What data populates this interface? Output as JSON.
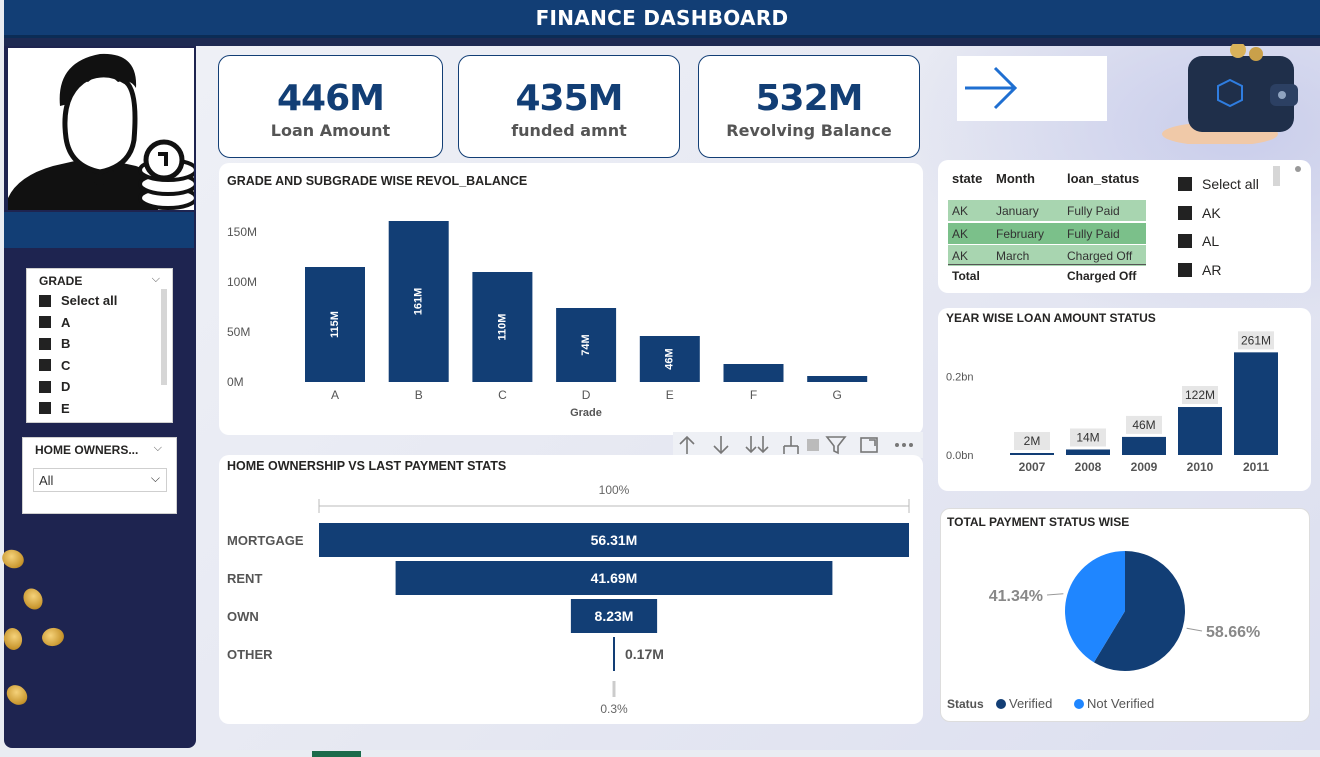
{
  "header": {
    "title": "FINANCE DASHBOARD"
  },
  "kpis": [
    {
      "value": "446M",
      "label": "Loan Amount"
    },
    {
      "value": "435M",
      "label": "funded amnt"
    },
    {
      "value": "532M",
      "label": "Revolving Balance"
    }
  ],
  "grade_slicer": {
    "title": "GRADE",
    "items": [
      "Select all",
      "A",
      "B",
      "C",
      "D",
      "E"
    ]
  },
  "home_slicer": {
    "title": "HOME OWNERS...",
    "selected": "All"
  },
  "state_table": {
    "headers": [
      "state",
      "Month",
      "loan_status"
    ],
    "rows": [
      [
        "AK",
        "January",
        "Fully Paid"
      ],
      [
        "AK",
        "February",
        "Fully Paid"
      ],
      [
        "AK",
        "March",
        "Charged Off"
      ]
    ],
    "total": [
      "Total",
      "",
      "Charged Off"
    ]
  },
  "state_slicer": {
    "items": [
      "Select all",
      "AK",
      "AL",
      "AR"
    ]
  },
  "colors": {
    "primary": "#123e75",
    "light_blue": "#1f86ff",
    "table_row": "#a8d5b0",
    "table_row_alt": "#7bc08a"
  },
  "chart_data": [
    {
      "type": "bar",
      "title": "GRADE AND SUBGRADE WISE REVOL_BALANCE",
      "xlabel": "Grade",
      "ylabel": "",
      "categories": [
        "A",
        "B",
        "C",
        "D",
        "E",
        "F",
        "G"
      ],
      "values": [
        115,
        161,
        110,
        74,
        46,
        18,
        6
      ],
      "data_labels": [
        "115M",
        "161M",
        "110M",
        "74M",
        "46M",
        "",
        ""
      ],
      "yticks": [
        "0M",
        "50M",
        "100M",
        "150M"
      ],
      "ylim": [
        0,
        170
      ],
      "unit": "M"
    },
    {
      "type": "bar",
      "title": "YEAR WISE LOAN AMOUNT STATUS",
      "categories": [
        "2007",
        "2008",
        "2009",
        "2010",
        "2011"
      ],
      "values": [
        2,
        14,
        46,
        122,
        261
      ],
      "data_labels": [
        "2M",
        "14M",
        "46M",
        "122M",
        "261M"
      ],
      "yticks": [
        "0.0bn",
        "0.2bn"
      ],
      "ylim": [
        0,
        300
      ]
    },
    {
      "type": "bar",
      "title": "HOME OWNERSHIP VS LAST PAYMENT STATS",
      "categories": [
        "MORTGAGE",
        "RENT",
        "OWN",
        "OTHER"
      ],
      "values": [
        56.31,
        41.69,
        8.23,
        0.17
      ],
      "data_labels": [
        "56.31M",
        "41.69M",
        "8.23M",
        "0.17M"
      ],
      "top_label": "100%",
      "bottom_label": "0.3%"
    },
    {
      "type": "pie",
      "title": "TOTAL PAYMENT STATUS WISE",
      "legend_title": "Status",
      "series": [
        {
          "name": "Verified",
          "value": 58.66,
          "label": "58.66%",
          "color": "#123e75"
        },
        {
          "name": "Not Verified",
          "value": 41.34,
          "label": "41.34%",
          "color": "#1f86ff"
        }
      ]
    }
  ]
}
